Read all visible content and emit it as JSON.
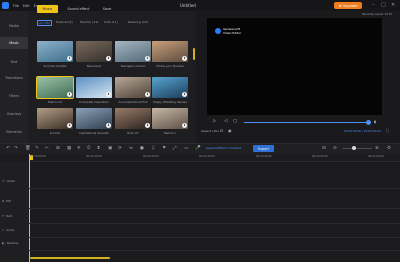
{
  "titlebar": {
    "title": "Untitled",
    "menu": [
      "File",
      "Edit",
      "Export",
      "Help"
    ],
    "upgrade_label": "Upgrade",
    "window_buttons": {
      "minimize": "–",
      "maximize": "□",
      "close": "✕"
    }
  },
  "sidebar": {
    "items": [
      {
        "label": "Media",
        "active": false
      },
      {
        "label": "Music",
        "active": true
      },
      {
        "label": "Text",
        "active": false
      },
      {
        "label": "Transitions",
        "active": false
      },
      {
        "label": "Filters",
        "active": false
      },
      {
        "label": "Overlays",
        "active": false
      },
      {
        "label": "Elements",
        "active": false
      }
    ]
  },
  "media": {
    "tabs": [
      "Music",
      "Sound effect",
      "Save"
    ],
    "active_tab": "Music",
    "subtabs": [
      "All (35)",
      "Festival (4)",
      "Fashion (11)",
      "Sofa (11)",
      "Relaxing (10)"
    ],
    "active_subtab": "All (35)",
    "items": [
      {
        "caption": "Summer Update",
        "colors": [
          "#8fb1c9",
          "#3e6f8c"
        ],
        "selected": false
      },
      {
        "caption": "Neverland",
        "colors": [
          "#7a6a5c",
          "#33302c"
        ],
        "selected": false
      },
      {
        "caption": "Teenager's dream",
        "colors": [
          "#a7b7c0",
          "#52687a"
        ],
        "selected": false
      },
      {
        "caption": "Follow your Dreams",
        "colors": [
          "#caa07a",
          "#5b4a3e"
        ],
        "selected": false
      },
      {
        "caption": "Fashion IV",
        "colors": [
          "#9bc3a4",
          "#3f6b55"
        ],
        "selected": true
      },
      {
        "caption": "Corporate Inspiration",
        "colors": [
          "#5b90c4",
          "#d7e6f1"
        ],
        "selected": false
      },
      {
        "caption": "Accomplishment Full",
        "colors": [
          "#b8a899",
          "#4d4036"
        ],
        "selected": false
      },
      {
        "caption": "Happy Whistling Ukulele",
        "colors": [
          "#58a4d1",
          "#1b3d5c"
        ],
        "selected": false
      },
      {
        "caption": "Inmotiv",
        "colors": [
          "#b39d86",
          "#3b2f27"
        ],
        "selected": false
      },
      {
        "caption": "Inspirational Acoustic",
        "colors": [
          "#8ca1b8",
          "#2f3f50"
        ],
        "selected": false
      },
      {
        "caption": "Rock 07",
        "colors": [
          "#9a7c6a",
          "#2b2320"
        ],
        "selected": false
      },
      {
        "caption": "Fashion I",
        "colors": [
          "#c7b9a8",
          "#5c5045"
        ],
        "selected": false
      }
    ]
  },
  "preview": {
    "save_status": "Recently saved 13:57",
    "watermark_line1": "Apowersoft",
    "watermark_line2": "Video Editor",
    "aspect_label": "Aspect ratio",
    "time_readout": "00:00:00:00 / 00:00:00:00"
  },
  "toolbar": {
    "sbfx_label": "Speech/Effect Contents",
    "export_label": "Export"
  },
  "timeline": {
    "ruler_labels": [
      "00:00:00:00",
      "00:00:10:00",
      "00:00:20:00",
      "00:00:30:00",
      "00:00:40:00",
      "00:00:50:00",
      "00:01:00:00"
    ],
    "tracks": [
      "Video",
      "PIP",
      "Text",
      "Audio",
      "Shadow"
    ]
  },
  "colors": {
    "accent_yellow": "#f0c419",
    "accent_blue": "#4f8df7",
    "upgrade_orange": "#ef7c1d"
  }
}
